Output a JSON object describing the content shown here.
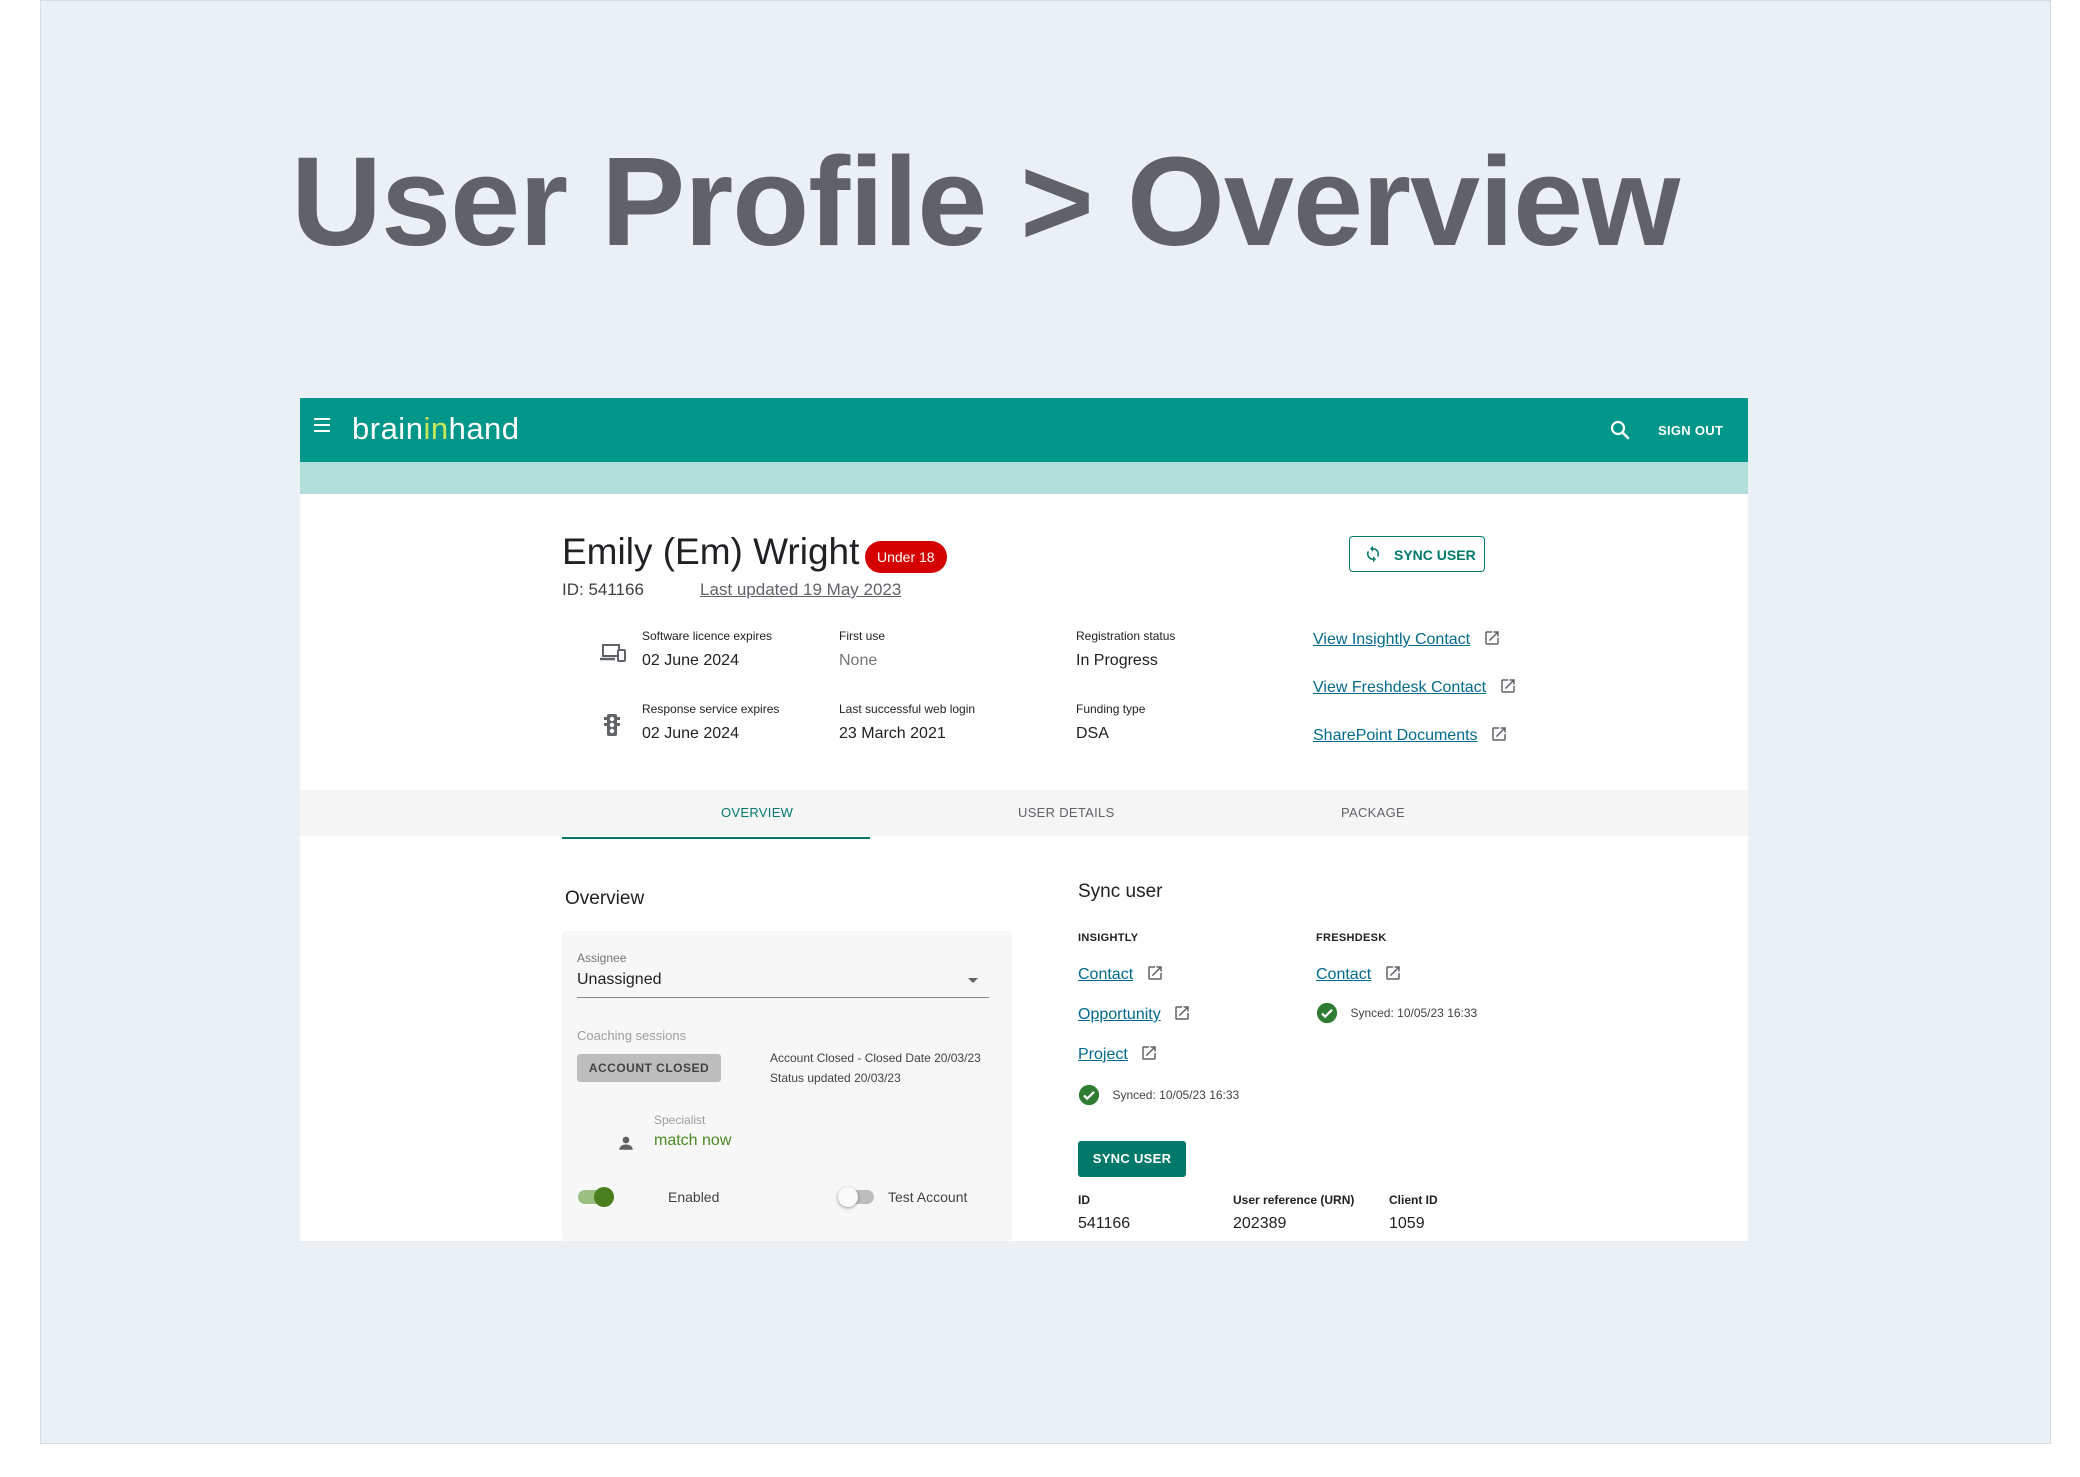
{
  "page": {
    "headline": "User Profile > Overview"
  },
  "topbar": {
    "logo_pre": "brain",
    "logo_in": "in",
    "logo_post": "hand",
    "sign_out": "SIGN OUT"
  },
  "profile": {
    "name": "Emily (Em) Wright",
    "badge": "Under 18",
    "id_text": "ID: 541166",
    "last_updated": "Last updated 19 May 2023",
    "sync_button": "SYNC USER",
    "fields": {
      "licence_label": "Software licence expires",
      "licence_value": "02 June 2024",
      "first_use_label": "First use",
      "first_use_value": "None",
      "reg_label": "Registration status",
      "reg_value": "In Progress",
      "response_label": "Response service expires",
      "response_value": "02 June 2024",
      "weblogin_label": "Last successful web login",
      "weblogin_value": "23 March 2021",
      "funding_label": "Funding type",
      "funding_value": "DSA"
    },
    "links": [
      "View Insightly Contact",
      "View Freshdesk Contact",
      "SharePoint Documents"
    ]
  },
  "tabs": [
    "OVERVIEW",
    "USER DETAILS",
    "PACKAGE"
  ],
  "overview": {
    "title": "Overview",
    "assignee_label": "Assignee",
    "assignee_value": "Unassigned",
    "coaching_label": "Coaching sessions",
    "account_closed": "ACCOUNT CLOSED",
    "closed_line1": "Account Closed - Closed Date 20/03/23",
    "closed_line2": "Status updated 20/03/23",
    "specialist_label": "Specialist",
    "specialist_value": "match now",
    "enabled_label": "Enabled",
    "test_label": "Test Account",
    "enabled_on": true,
    "test_on": false
  },
  "sync": {
    "title": "Sync user",
    "insightly_heading": "INSIGHTLY",
    "freshdesk_heading": "FRESHDESK",
    "insightly_links": [
      "Contact",
      "Opportunity",
      "Project"
    ],
    "freshdesk_links": [
      "Contact"
    ],
    "insightly_synced": "Synced: 10/05/23 16:33",
    "freshdesk_synced": "Synced: 10/05/23 16:33",
    "button": "SYNC USER",
    "id_label": "ID",
    "id_value": "541166",
    "urn_label": "User reference (URN)",
    "urn_value": "202389",
    "client_label": "Client ID",
    "client_value": "1059"
  },
  "colors": {
    "brand": "#00968a",
    "accent": "#00796b",
    "badge": "#d50000",
    "link": "#006a8e",
    "specialist": "#4a8a1f"
  }
}
